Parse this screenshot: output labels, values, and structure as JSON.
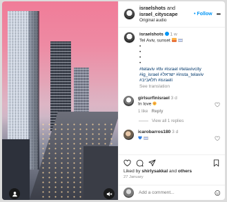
{
  "header": {
    "username": "israelshots",
    "and_text": "and",
    "collab": "israel_cityscape",
    "audio": "Original audio",
    "follow_label": "• Follow",
    "more_label": "•••"
  },
  "caption": {
    "username": "israelshots",
    "time": "1 w",
    "line1": "Tel Aviv, sunset",
    "bullets": [
      "•",
      "•",
      "•",
      "•"
    ],
    "hashtags_line1": "#telaviv #tlv #israel #telavivcity",
    "hashtags_line2": "#ig_israel #ישראל #insta_telaviv",
    "hashtags_line3": "#תלאביב #israeli",
    "see_translation": "See translation"
  },
  "comments": [
    {
      "username": "girlsurfinisrael",
      "time": "3 d",
      "text": "In love",
      "likes": "1 like",
      "reply": "Reply"
    },
    {
      "username": "icarobarros180",
      "time": "3 d",
      "text": ""
    }
  ],
  "view_replies": "View all 1 replies",
  "likes": {
    "prefix": "Liked by",
    "user": "shirlysakkal",
    "and": "and",
    "others": "others"
  },
  "date": "27 January",
  "add_comment": {
    "placeholder": "Add a comment..."
  },
  "icons": {
    "like": "heart-icon",
    "comment": "comment-icon",
    "share": "send-icon",
    "save": "bookmark-icon",
    "tag": "person-tag-icon",
    "mute": "speaker-muted-icon",
    "emoji": "smiley-icon"
  }
}
